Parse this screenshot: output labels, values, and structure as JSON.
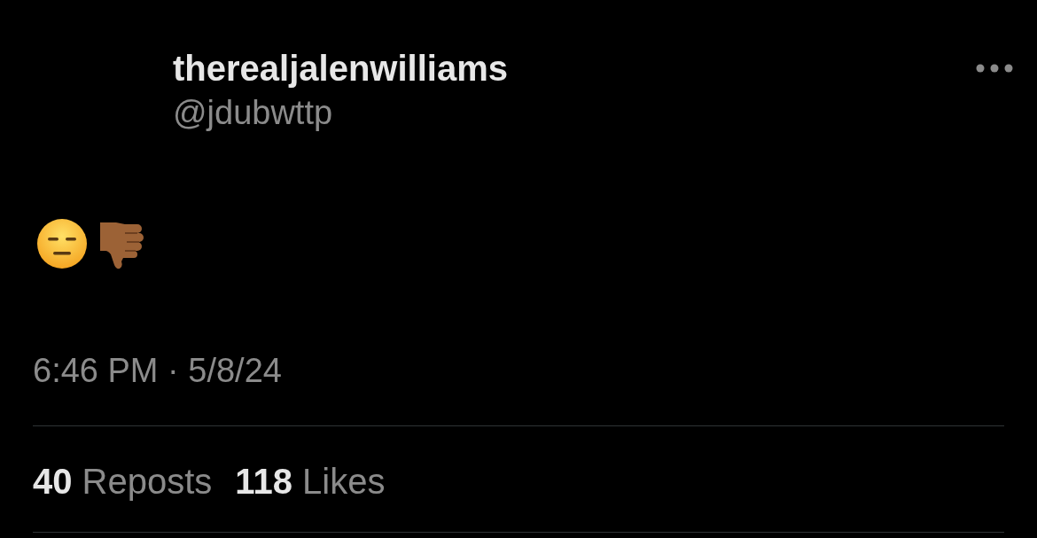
{
  "author": {
    "name": "therealjalenwilliams",
    "handle": "@jdubwttp"
  },
  "body": [
    {
      "kind": "expressionless"
    },
    {
      "kind": "thumbs_down"
    }
  ],
  "timestamp": "6:46 PM · 5/8/24",
  "stats": [
    {
      "count": "40",
      "label": "Reposts"
    },
    {
      "count": "118",
      "label": "Likes"
    }
  ]
}
